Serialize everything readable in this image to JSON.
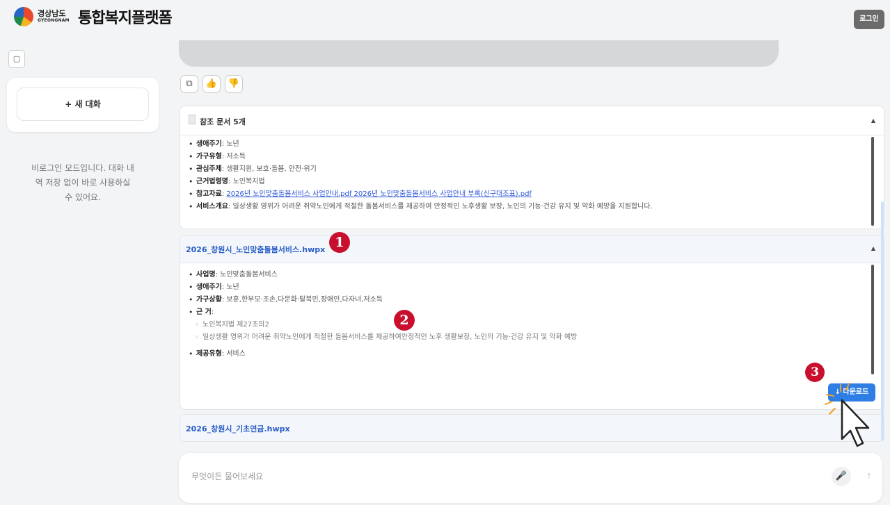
{
  "header": {
    "logo_kr": "경상남도",
    "logo_en": "GYEONGNAM",
    "title": "통합복지플랫폼",
    "login_label": "로그인"
  },
  "sidebar": {
    "toggle_icon": "sidebar-toggle-icon",
    "new_chat_label": "+ 새 대화",
    "guest_notice": "비로그인 모드입니다. 대화 내역 저장 없이 바로 사용하실 수 있어요."
  },
  "message_actions": {
    "copy_icon": "⧉",
    "like_icon": "👍",
    "dislike_icon": "👎"
  },
  "references": {
    "title": "참조 문서 5개",
    "items": [
      {
        "label": "생애주기",
        "value": ": 노년"
      },
      {
        "label": "가구유형",
        "value": ": 저소득"
      },
      {
        "label": "관심주제",
        "value": ": 생활지원, 보호·돌봄, 안전·위기"
      },
      {
        "label": "근거법령명",
        "value": ": 노인복지법"
      },
      {
        "label": "참고자료",
        "value": ": "
      },
      {
        "label": "서비스개요",
        "value": ": 일상생활 영위가 어려운 취약노인에게 적절한 돌봄서비스를 제공하여 안정적인 노후생활 보장, 노인의 기능·건강 유지 및 악화 예방을 지원합니다."
      }
    ],
    "links": "2026년 노인맞춤돌봄서비스 사업안내.pdf 2026년 노인맞춤돌봄서비스 사업안내 부록(신구대조표).pdf"
  },
  "file1": {
    "title": "2026_창원시_노인맞춤돌봄서비스.hwpx",
    "items": [
      {
        "label": "사업명",
        "value": ": 노인맞춤돌봄서비스"
      },
      {
        "label": "생애주기",
        "value": ": 노년"
      },
      {
        "label": "가구상황",
        "value": ": 보훈,한부모·조손,다문화·탈북민,장애인,다자녀,저소득"
      },
      {
        "label": "근 거",
        "value": ":"
      }
    ],
    "sub_items": [
      "노인복지법 제27조의2",
      "일상생활 영위가 어려운 취약노인에게 적절한 돌봄서비스를 제공하여안정적인 노후 생활보장, 노인의 기능·건강 유지 및 악화 예방"
    ],
    "last_item": {
      "label": "제공유형",
      "value": ": 서비스"
    },
    "download_label": "↓ 다운로드"
  },
  "file2": {
    "title": "2026_창원시_기초연금.hwpx"
  },
  "markers": [
    "1",
    "2",
    "3"
  ],
  "chat_input": {
    "placeholder": "무엇이든 물어보세요"
  },
  "colors": {
    "link": "#2b55d6",
    "file_title": "#2a5cc6",
    "download_button": "#2f7ee6",
    "marker": "#c8102e"
  }
}
